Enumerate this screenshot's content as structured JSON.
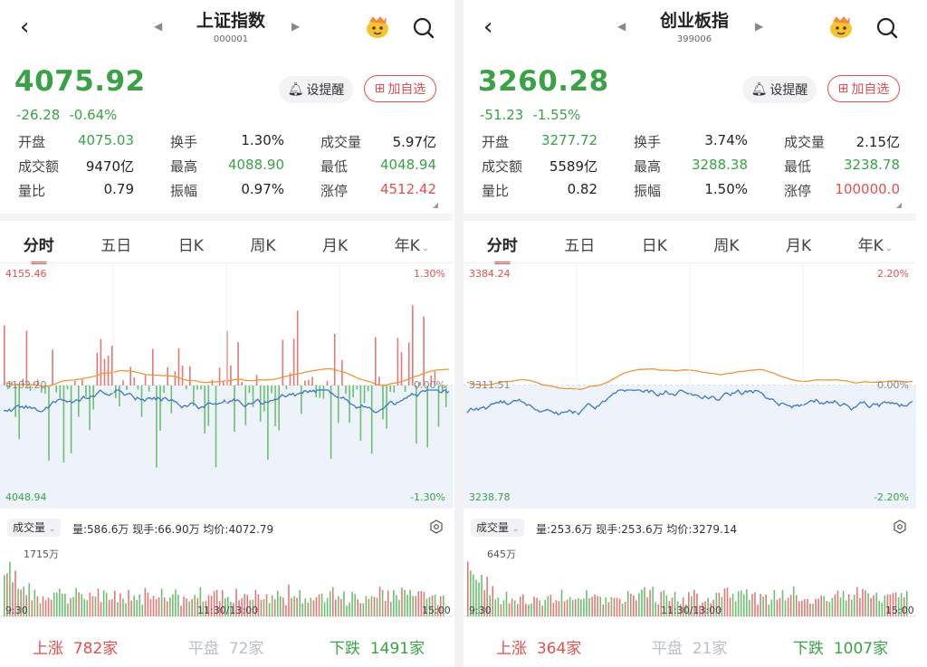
{
  "panels": [
    {
      "title": "上证指数",
      "code": "000001",
      "price": "4075.92",
      "change": "-26.28",
      "change_pct": "-0.64%",
      "alert_label": "设提醒",
      "add_label": "加自选",
      "stats": [
        [
          {
            "k": "开盘",
            "v": "4075.03",
            "c": "green"
          },
          {
            "k": "换手",
            "v": "1.30%",
            "c": "dark"
          },
          {
            "k": "成交量",
            "v": "5.97亿",
            "c": "dark"
          }
        ],
        [
          {
            "k": "成交额",
            "v": "9470亿",
            "c": "dark"
          },
          {
            "k": "最高",
            "v": "4088.90",
            "c": "green"
          },
          {
            "k": "最低",
            "v": "4048.94",
            "c": "green"
          }
        ],
        [
          {
            "k": "量比",
            "v": "0.79",
            "c": "dark"
          },
          {
            "k": "振幅",
            "v": "0.97%",
            "c": "dark"
          },
          {
            "k": "涨停",
            "v": "4512.42",
            "c": "red"
          }
        ]
      ],
      "tabs": [
        "分时",
        "五日",
        "日K",
        "周K",
        "月K",
        "年K"
      ],
      "chart": {
        "y_top": "4155.46",
        "y_mid": "4102.20",
        "y_bot": "4048.94",
        "pct_top": "1.30%",
        "pct_mid": "0.00%",
        "pct_bot": "-1.30%"
      },
      "volume": {
        "selector": "成交量",
        "info": "量:586.6万  现手:66.90万  均价:4072.79",
        "max": "1715万"
      },
      "times": [
        "9:30",
        "11:30/13:00",
        "15:00"
      ],
      "market": {
        "up_label": "上涨",
        "up": "782家",
        "flat_label": "平盘",
        "flat": "72家",
        "down_label": "下跌",
        "down": "1491家"
      }
    },
    {
      "title": "创业板指",
      "code": "399006",
      "price": "3260.28",
      "change": "-51.23",
      "change_pct": "-1.55%",
      "alert_label": "设提醒",
      "add_label": "加自选",
      "stats": [
        [
          {
            "k": "开盘",
            "v": "3277.72",
            "c": "green"
          },
          {
            "k": "换手",
            "v": "3.74%",
            "c": "dark"
          },
          {
            "k": "成交量",
            "v": "2.15亿",
            "c": "dark"
          }
        ],
        [
          {
            "k": "成交额",
            "v": "5589亿",
            "c": "dark"
          },
          {
            "k": "最高",
            "v": "3288.38",
            "c": "green"
          },
          {
            "k": "最低",
            "v": "3238.78",
            "c": "green"
          }
        ],
        [
          {
            "k": "量比",
            "v": "0.82",
            "c": "dark"
          },
          {
            "k": "振幅",
            "v": "1.50%",
            "c": "dark"
          },
          {
            "k": "涨停",
            "v": "100000.0",
            "c": "red"
          }
        ]
      ],
      "tabs": [
        "分时",
        "五日",
        "日K",
        "周K",
        "月K",
        "年K"
      ],
      "chart": {
        "y_top": "3384.24",
        "y_mid": "3311.51",
        "y_bot": "3238.78",
        "pct_top": "2.20%",
        "pct_mid": "0.00%",
        "pct_bot": "-2.20%"
      },
      "volume": {
        "selector": "成交量",
        "info": "量:253.6万  现手:253.6万  均价:3279.14",
        "max": "645万"
      },
      "times": [
        "9:30",
        "11:30/13:00",
        "15:00"
      ],
      "market": {
        "up_label": "上涨",
        "up": "364家",
        "flat_label": "平盘",
        "flat": "21家",
        "down_label": "下跌",
        "down": "1007家"
      }
    }
  ],
  "colors": {
    "up": "#e0504c",
    "down": "#3aa245",
    "price_line": "#3a78c5",
    "avg_line": "#f0953a",
    "flat": "#b9bfc8"
  }
}
